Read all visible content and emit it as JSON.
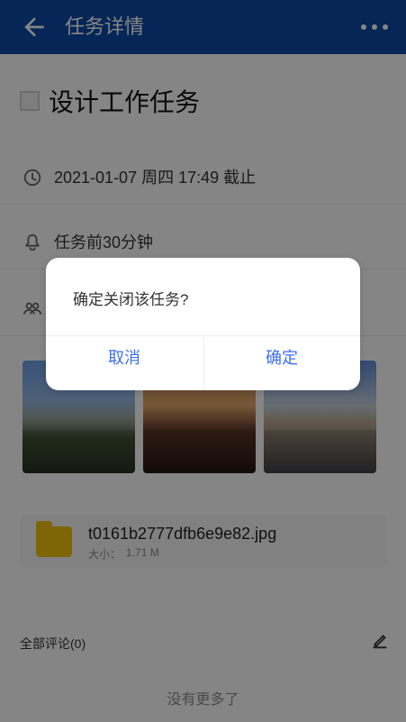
{
  "header": {
    "title": "任务详情",
    "bg_color": "#0b4aa6",
    "icons": [
      "back-arrow-icon",
      "more-icon"
    ]
  },
  "task": {
    "title": "设计工作任务",
    "checked": false
  },
  "details": {
    "deadline": "2021-01-07 周四 17:49 截止",
    "reminder": "任务前30分钟"
  },
  "attachments": {
    "file_name": "t0161b2777dfb6e9e82.jpg",
    "size_label": "大小：",
    "size_value": "1.71 M"
  },
  "comments": {
    "label": "全部评论(0)",
    "no_more": "没有更多了"
  },
  "dialog": {
    "message": "确定关闭该任务?",
    "cancel_label": "取消",
    "ok_label": "确定",
    "accent_color": "#3c6ff3"
  }
}
